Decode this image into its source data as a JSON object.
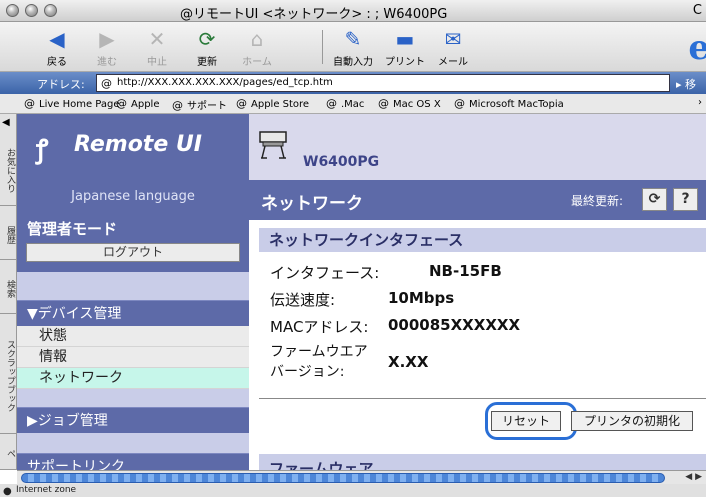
{
  "window": {
    "title": "@リモートUI <ネットワーク> : ; W6400PG",
    "title_right": "C"
  },
  "toolbar": {
    "back": "戻る",
    "forward": "進む",
    "stop": "中止",
    "refresh": "更新",
    "home": "ホーム",
    "autofill": "自動入力",
    "print": "プリント",
    "mail": "メール"
  },
  "address": {
    "label": "アドレス:",
    "url": "http://XXX.XXX.XXX.XXX/pages/ed_tcp.htm",
    "go_label": "移"
  },
  "favorites": [
    "Live Home Page",
    "Apple",
    "サポート",
    "Apple Store",
    ".Mac",
    "Mac OS X",
    "Microsoft MacTopia"
  ],
  "side_tabs": [
    "お気に入り",
    "履歴",
    "検索",
    "スクラップブック",
    "ペ"
  ],
  "nav": {
    "logo_text": "Remote UI",
    "language": "Japanese language",
    "admin_mode": "管理者モード",
    "logout": "ログアウト",
    "device_mgmt": "▼デバイス管理",
    "items": [
      "状態",
      "情報",
      "ネットワーク"
    ],
    "job_mgmt": "▶ジョブ管理",
    "support_link": "サポートリンク"
  },
  "main": {
    "model": "W6400PG",
    "page_title": "ネットワーク",
    "last_updated": "最終更新:",
    "refresh_symbol": "⟳",
    "help_symbol": "?",
    "section_title": "ネットワークインタフェース",
    "rows": [
      {
        "label": "インタフェース:",
        "value": "NB-15FB"
      },
      {
        "label": "伝送速度:",
        "value": "10Mbps"
      },
      {
        "label": "MACアドレス:",
        "value": "000085XXXXXX"
      },
      {
        "label": "ファームウエア バージョン:",
        "value": "X.XX"
      }
    ],
    "reset_button": "リセット",
    "init_button": "プリンタの初期化",
    "next_section": "ファームウェア"
  },
  "status": {
    "zone": "Internet zone"
  },
  "colors": {
    "accent": "#5d6aa8",
    "band_light": "#c9cde8",
    "active_item": "#c6f6ea",
    "highlight_ring": "#2a6fd6"
  }
}
